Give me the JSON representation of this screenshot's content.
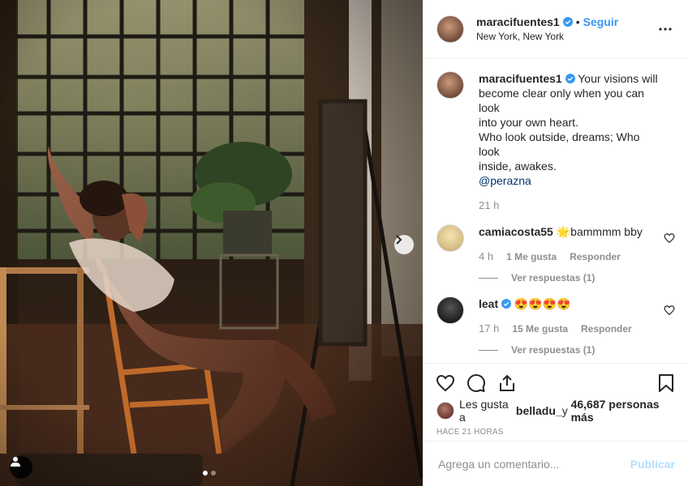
{
  "header": {
    "username": "maracifuentes1",
    "separator": "•",
    "follow_label": "Seguir",
    "location": "New York, New York",
    "more_icon": "more-horizontal-icon"
  },
  "caption": {
    "username": "maracifuentes1",
    "lines": [
      "Your visions will",
      "become clear only when you can look",
      "into your own heart.",
      "Who look outside, dreams; Who look",
      "inside, awakes."
    ],
    "mention": "@perazna",
    "time": "21 h"
  },
  "comments": [
    {
      "username": "camiacosta55",
      "emoji": "🌟",
      "text": "bammmm bby",
      "time": "4 h",
      "likes": "1 Me gusta",
      "reply": "Responder",
      "replies": "Ver respuestas (1)"
    },
    {
      "username": "leat",
      "emoji": "😍😍😍😍",
      "text": "",
      "time": "17 h",
      "likes": "15 Me gusta",
      "reply": "Responder",
      "replies": "Ver respuestas (1)"
    }
  ],
  "likes_bar": {
    "prefix": "Les gusta a ",
    "user": "belladu_",
    "middle": " y ",
    "count": "46,687 personas más"
  },
  "time_ago": "HACE 21 HORAS",
  "add_comment": {
    "placeholder": "Agrega un comentario...",
    "publish_label": "Publicar"
  },
  "carousel": {
    "total": 2,
    "active": 1
  },
  "colors": {
    "link": "#3897f0",
    "verified": "#3897f0",
    "publish_disabled": "#b2dffc",
    "muted": "#8e8e8e"
  }
}
